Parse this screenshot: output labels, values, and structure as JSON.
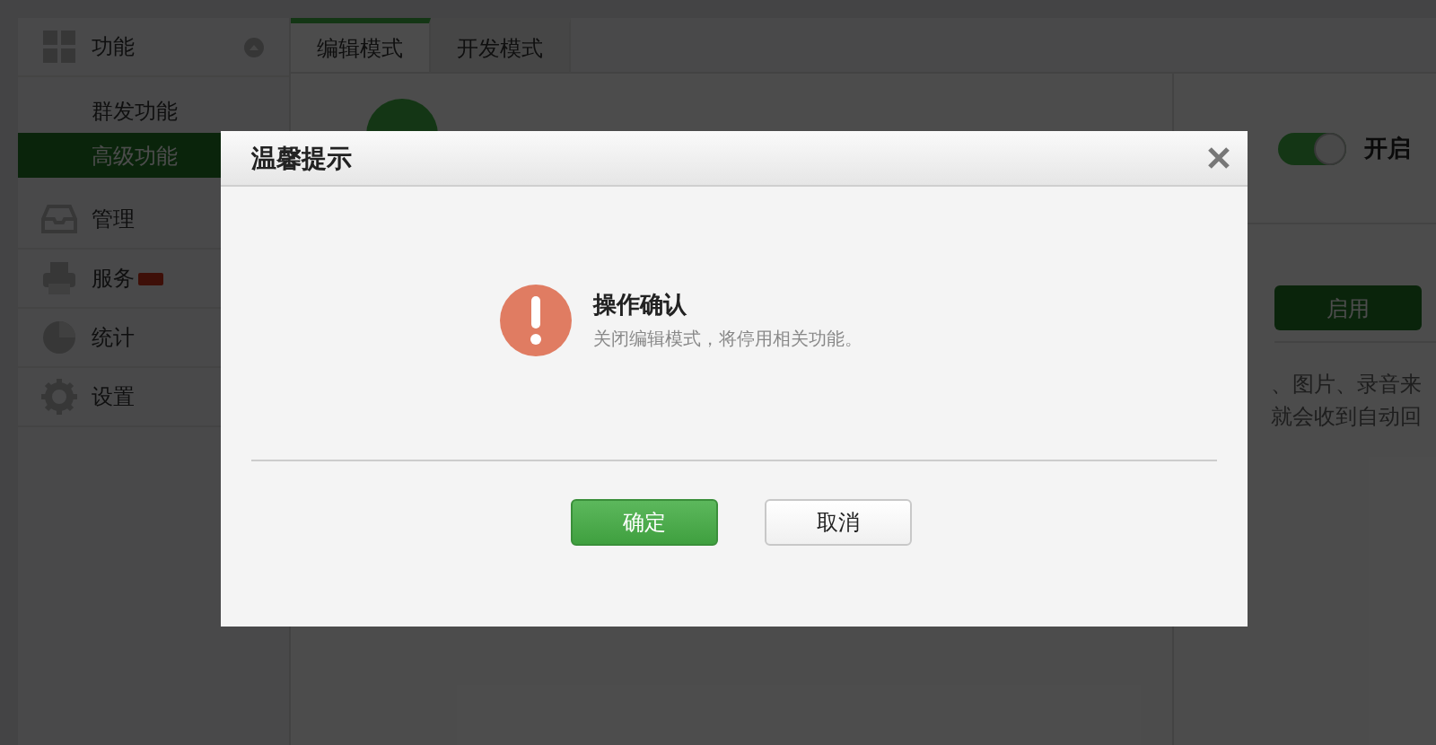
{
  "sidebar": {
    "items": [
      {
        "kind": "section",
        "label": "功能",
        "expanded": true,
        "new": false
      },
      {
        "kind": "sub",
        "label": "群发功能",
        "selected": false
      },
      {
        "kind": "sub",
        "label": "高级功能",
        "selected": true
      },
      {
        "kind": "section",
        "label": "管理",
        "new": false
      },
      {
        "kind": "section",
        "label": "服务",
        "new": true
      },
      {
        "kind": "section",
        "label": "统计",
        "new": false
      },
      {
        "kind": "section",
        "label": "设置",
        "new": false
      }
    ]
  },
  "tabs": [
    {
      "label": "编辑模式",
      "selected": true
    },
    {
      "label": "开发模式",
      "selected": false
    }
  ],
  "panel": {
    "toggle": {
      "on": true,
      "label": "开启"
    },
    "button": "启用",
    "description": [
      "、图片、录音来",
      "就会收到自动回"
    ]
  },
  "dialog": {
    "title": "温馨提示",
    "heading": "操作确认",
    "message": "关闭编辑模式，将停用相关功能。",
    "buttons": [
      {
        "label": "确定",
        "kind": "primary"
      },
      {
        "label": "取消",
        "kind": "secondary"
      }
    ]
  }
}
